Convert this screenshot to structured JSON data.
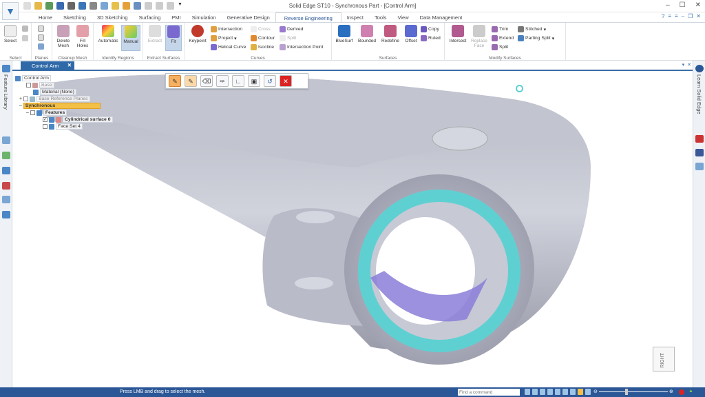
{
  "app": {
    "title": "Solid Edge ST10 - Synchronous Part - [Control Arm]"
  },
  "tabs": [
    "Home",
    "Sketching",
    "3D Sketching",
    "Surfacing",
    "PMI",
    "Simulation",
    "Generative Design",
    "Reverse Engineering",
    "Inspect",
    "Tools",
    "View",
    "Data Management"
  ],
  "active_tab": "Reverse Engineering",
  "ribbon": {
    "select": {
      "label": "Select",
      "group": "Select"
    },
    "planes": {
      "group": "Planes"
    },
    "cleanup": {
      "delete": "Delete Mesh",
      "fill": "Fill Holes",
      "group": "Cleanup Mesh"
    },
    "identify": {
      "automatic": "Automatic",
      "manual": "Manual",
      "group": "Identify Regions"
    },
    "extract": {
      "extract": "Extract",
      "fit": "Fit",
      "group": "Extract Surfaces"
    },
    "curves": {
      "keypoint": "Keypoint",
      "intersection": "Intersection",
      "project": "Project",
      "helical": "Helical Curve",
      "cross": "Cross",
      "contour": "Contour",
      "isocline": "Isocline",
      "derived": "Derived",
      "split": "Split",
      "intersection_point": "Intersection Point",
      "group": "Curves"
    },
    "surfaces": {
      "bluesurf": "BlueSurf",
      "bounded": "Bounded",
      "redefine": "Redefine",
      "offset": "Offset",
      "copy": "Copy",
      "ruled": "Ruled",
      "group": "Surfaces"
    },
    "modify": {
      "intersect": "Intersect",
      "replace": "Replace Face",
      "trim": "Trim",
      "extend": "Extend",
      "split": "Split",
      "stitched": "Stitched",
      "parting": "Parting Split",
      "group": "Modify Surfaces"
    }
  },
  "document_tab": "Control Arm",
  "left_panel": {
    "label": "Feature Library"
  },
  "right_panel": {
    "label": "Learn Solid Edge"
  },
  "tree": {
    "root": "Control Arm",
    "items": [
      "Base",
      "Material (None)",
      "Base Reference Planes",
      "Synchronous",
      "Features",
      "Cylindrical surface 0",
      "Face Set 4"
    ]
  },
  "view_cube": {
    "label": "RIGHT"
  },
  "status": {
    "message": "Press LMB and drag to select the mesh.",
    "command_placeholder": "Find a command"
  },
  "colors": {
    "accent": "#2b5797",
    "mesh": "#c4c6d2",
    "region": "#5fd0d2",
    "highlight": "#f3c047"
  }
}
